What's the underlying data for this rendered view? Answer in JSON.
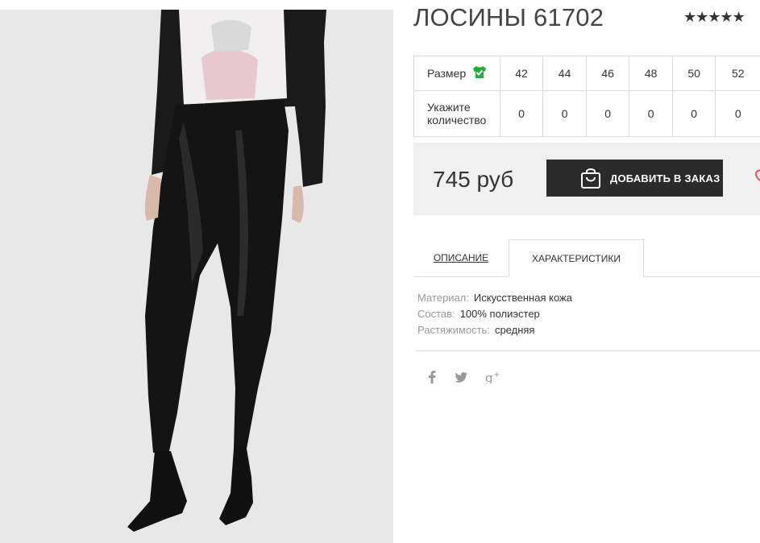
{
  "product": {
    "title": "ЛОСИНЫ 61702",
    "rating_stars": "★★★★★",
    "price": "745 руб"
  },
  "sizes": {
    "size_label": "Размер",
    "qty_label": "Укажите количество",
    "values": [
      "42",
      "44",
      "46",
      "48",
      "50",
      "52"
    ],
    "quantities": [
      "0",
      "0",
      "0",
      "0",
      "0",
      "0"
    ]
  },
  "actions": {
    "add_to_order": "ДОБАВИТЬ В ЗАКАЗ"
  },
  "tabs": {
    "description": "ОПИСАНИЕ",
    "characteristics": "ХАРАКТЕРИСТИКИ"
  },
  "specs": [
    {
      "key": "Материал:",
      "value": "Искусственная кожа"
    },
    {
      "key": "Состав:",
      "value": "100% полиэстер"
    },
    {
      "key": "Растяжимость:",
      "value": "средняя"
    }
  ],
  "social": {
    "facebook": "f",
    "twitter": "🐦",
    "google": "g+"
  },
  "icons": {
    "size_guide": "tshirt-check-icon",
    "bag": "shopping-bag-icon",
    "wishlist": "heart-icon"
  },
  "colors": {
    "accent_green": "#1fae3c",
    "button_dark": "#2b2b2b",
    "heart_red": "#e25555"
  }
}
